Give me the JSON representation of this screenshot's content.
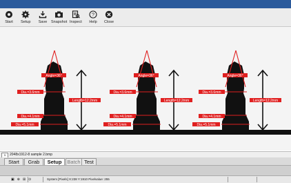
{
  "toolbar": {
    "items": [
      {
        "label": "Start",
        "icon": "start-icon"
      },
      {
        "label": "Setup",
        "icon": "gear-icon"
      },
      {
        "label": "Save",
        "icon": "save-icon"
      },
      {
        "label": "Snapshot",
        "icon": "camera-icon"
      },
      {
        "label": "Inspect",
        "icon": "inspect-icon"
      },
      {
        "label": "Help",
        "icon": "help-icon"
      },
      {
        "label": "Close",
        "icon": "close-icon"
      }
    ]
  },
  "measurements": {
    "angle": "Angle=36°",
    "dia_top": "Dia.=3.6mm",
    "length": "Length=12.2mm",
    "dia_mid": "Dia.=4.1mm",
    "dia_base": "Dia.=5.1mm"
  },
  "colors": {
    "accent": "#2c5b9c",
    "annotation_red": "#e02020"
  },
  "status": {
    "file": "2048x1912-8  sample 2.bmp",
    "index": "1"
  },
  "tabs": [
    {
      "label": "Start",
      "active": false
    },
    {
      "label": "Grab",
      "active": false
    },
    {
      "label": "Setup",
      "active": true
    },
    {
      "label": "Batch",
      "active": false
    },
    {
      "label": "Test",
      "active": false
    }
  ],
  "bottom": {
    "pixel_info": "System  [Pixels]  X:238  Y:1910  Pixelvalue: 255"
  }
}
